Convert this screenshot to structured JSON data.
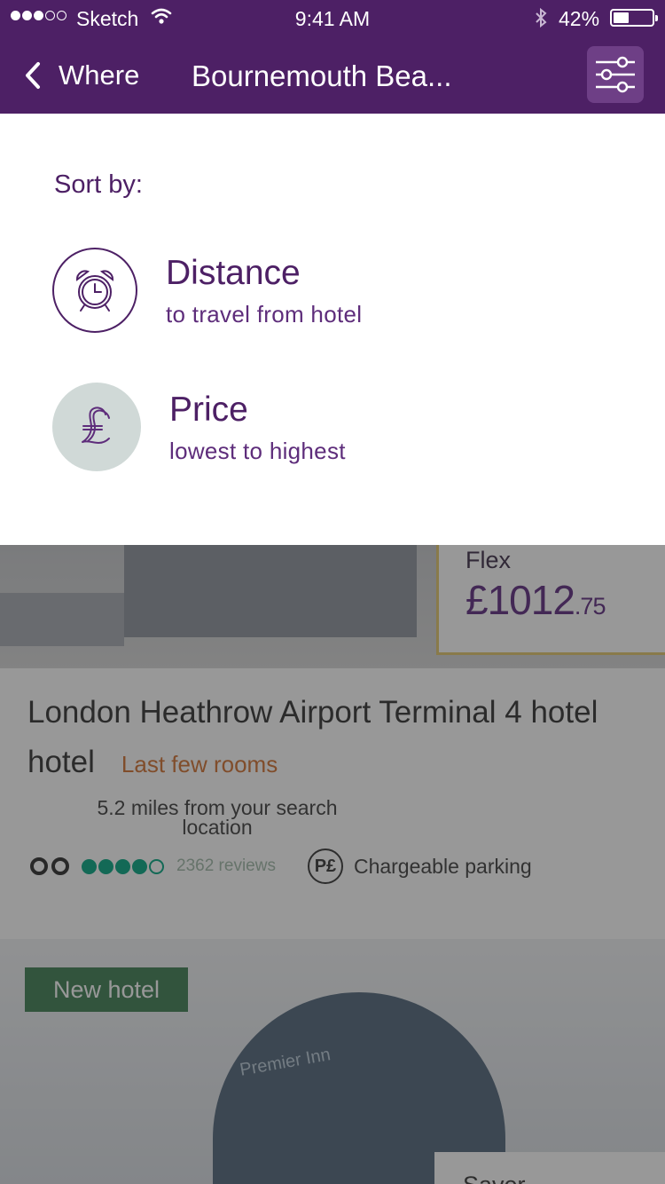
{
  "status_bar": {
    "carrier": "Sketch",
    "time": "9:41 AM",
    "battery": "42%"
  },
  "nav": {
    "back_label": "Where",
    "title": "Bournemouth Bea..."
  },
  "sort": {
    "heading": "Sort by:",
    "options": [
      {
        "title": "Distance",
        "subtitle": "to travel from hotel",
        "icon": "alarm-clock-icon"
      },
      {
        "title": "Price",
        "subtitle": "lowest to highest",
        "icon": "pound-sign-icon"
      }
    ]
  },
  "hotels": [
    {
      "rate_name": "Flex",
      "price_main": "£1012",
      "price_decimal": ".75",
      "name": "London Heathrow Airport Terminal 4 hotel hotel",
      "availability": "Last few rooms",
      "distance": "5.2 miles from your search location",
      "reviews": "2362 reviews",
      "parking": "Chargeable parking"
    },
    {
      "badge": "New hotel",
      "sign": "Premier Inn",
      "rate_name": "Saver"
    }
  ],
  "colors": {
    "brand_purple": "#4d2065",
    "price_border": "#e2c56a",
    "last_rooms": "#d2702f",
    "new_badge": "#3c7d52",
    "tripadvisor": "#00a680"
  }
}
